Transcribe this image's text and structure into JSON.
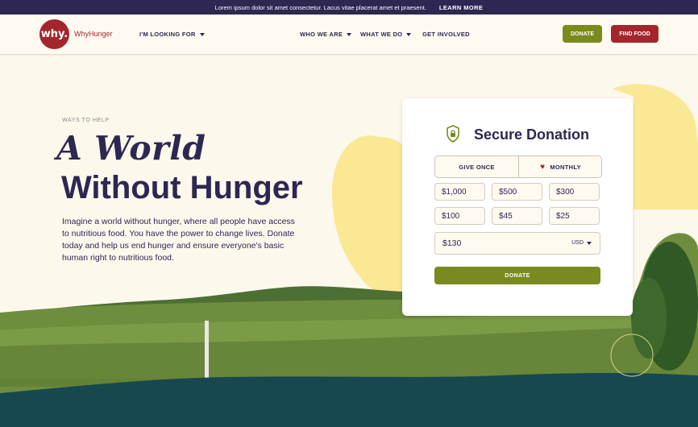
{
  "topbar": {
    "message": "Lorem ipsum dolor sit amet consectetur. Lacus vitae placerat amet et praesent.",
    "cta": "LEARN MORE"
  },
  "nav": {
    "logo_text": "why.",
    "brand": "WhyHunger",
    "looking_for": "I'M LOOKING FOR",
    "who_we_are": "WHO WE ARE",
    "what_we_do": "WHAT WE DO",
    "get_involved": "GET INVOLVED",
    "donate": "DONATE",
    "find_food": "FIND FOOD"
  },
  "hero": {
    "kicker": "WAYS TO HELP",
    "title_script": "A World",
    "title_main": "Without Hunger",
    "intro": "Imagine a world without hunger, where all people have access to nutritious food. You have the power to change lives. Donate today and help us end hunger and ensure everyone's basic human right to nutritious food."
  },
  "donation": {
    "title": "Secure Donation",
    "give_once": "GIVE ONCE",
    "monthly": "MONTHLY",
    "amounts": [
      "$1,000",
      "$500",
      "$300",
      "$100",
      "$45",
      "$25"
    ],
    "custom_amount": "$130",
    "currency": "USD",
    "donate_button": "DONATE"
  },
  "colors": {
    "navy": "#2d2752",
    "red": "#a3262d",
    "olive": "#7a8a1e",
    "cream": "#fdf8ec",
    "yellow": "#fbe894",
    "teal": "#174850"
  }
}
